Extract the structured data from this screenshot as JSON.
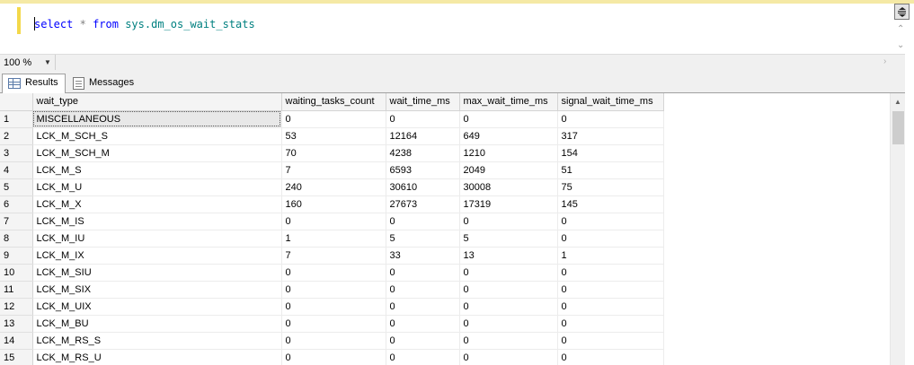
{
  "editor": {
    "query_tokens": [
      {
        "text": "select",
        "kind": "kw"
      },
      {
        "text": " ",
        "kind": "plain"
      },
      {
        "text": "*",
        "kind": "op"
      },
      {
        "text": " ",
        "kind": "plain"
      },
      {
        "text": "from",
        "kind": "kw"
      },
      {
        "text": " ",
        "kind": "plain"
      },
      {
        "text": "sys.dm_os_wait_stats",
        "kind": "id"
      }
    ]
  },
  "zoom": {
    "value": "100 %"
  },
  "tabs": [
    {
      "label": "Results",
      "icon": "results-grid-icon",
      "active": true
    },
    {
      "label": "Messages",
      "icon": "messages-icon",
      "active": false
    }
  ],
  "grid": {
    "columns": [
      "wait_type",
      "waiting_tasks_count",
      "wait_time_ms",
      "max_wait_time_ms",
      "signal_wait_time_ms"
    ],
    "rows": [
      [
        "1",
        "MISCELLANEOUS",
        "0",
        "0",
        "0",
        "0"
      ],
      [
        "2",
        "LCK_M_SCH_S",
        "53",
        "12164",
        "649",
        "317"
      ],
      [
        "3",
        "LCK_M_SCH_M",
        "70",
        "4238",
        "1210",
        "154"
      ],
      [
        "4",
        "LCK_M_S",
        "7",
        "6593",
        "2049",
        "51"
      ],
      [
        "5",
        "LCK_M_U",
        "240",
        "30610",
        "30008",
        "75"
      ],
      [
        "6",
        "LCK_M_X",
        "160",
        "27673",
        "17319",
        "145"
      ],
      [
        "7",
        "LCK_M_IS",
        "0",
        "0",
        "0",
        "0"
      ],
      [
        "8",
        "LCK_M_IU",
        "1",
        "5",
        "5",
        "0"
      ],
      [
        "9",
        "LCK_M_IX",
        "7",
        "33",
        "13",
        "1"
      ],
      [
        "10",
        "LCK_M_SIU",
        "0",
        "0",
        "0",
        "0"
      ],
      [
        "11",
        "LCK_M_SIX",
        "0",
        "0",
        "0",
        "0"
      ],
      [
        "12",
        "LCK_M_UIX",
        "0",
        "0",
        "0",
        "0"
      ],
      [
        "13",
        "LCK_M_BU",
        "0",
        "0",
        "0",
        "0"
      ],
      [
        "14",
        "LCK_M_RS_S",
        "0",
        "0",
        "0",
        "0"
      ],
      [
        "15",
        "LCK_M_RS_U",
        "0",
        "0",
        "0",
        "0"
      ]
    ]
  }
}
